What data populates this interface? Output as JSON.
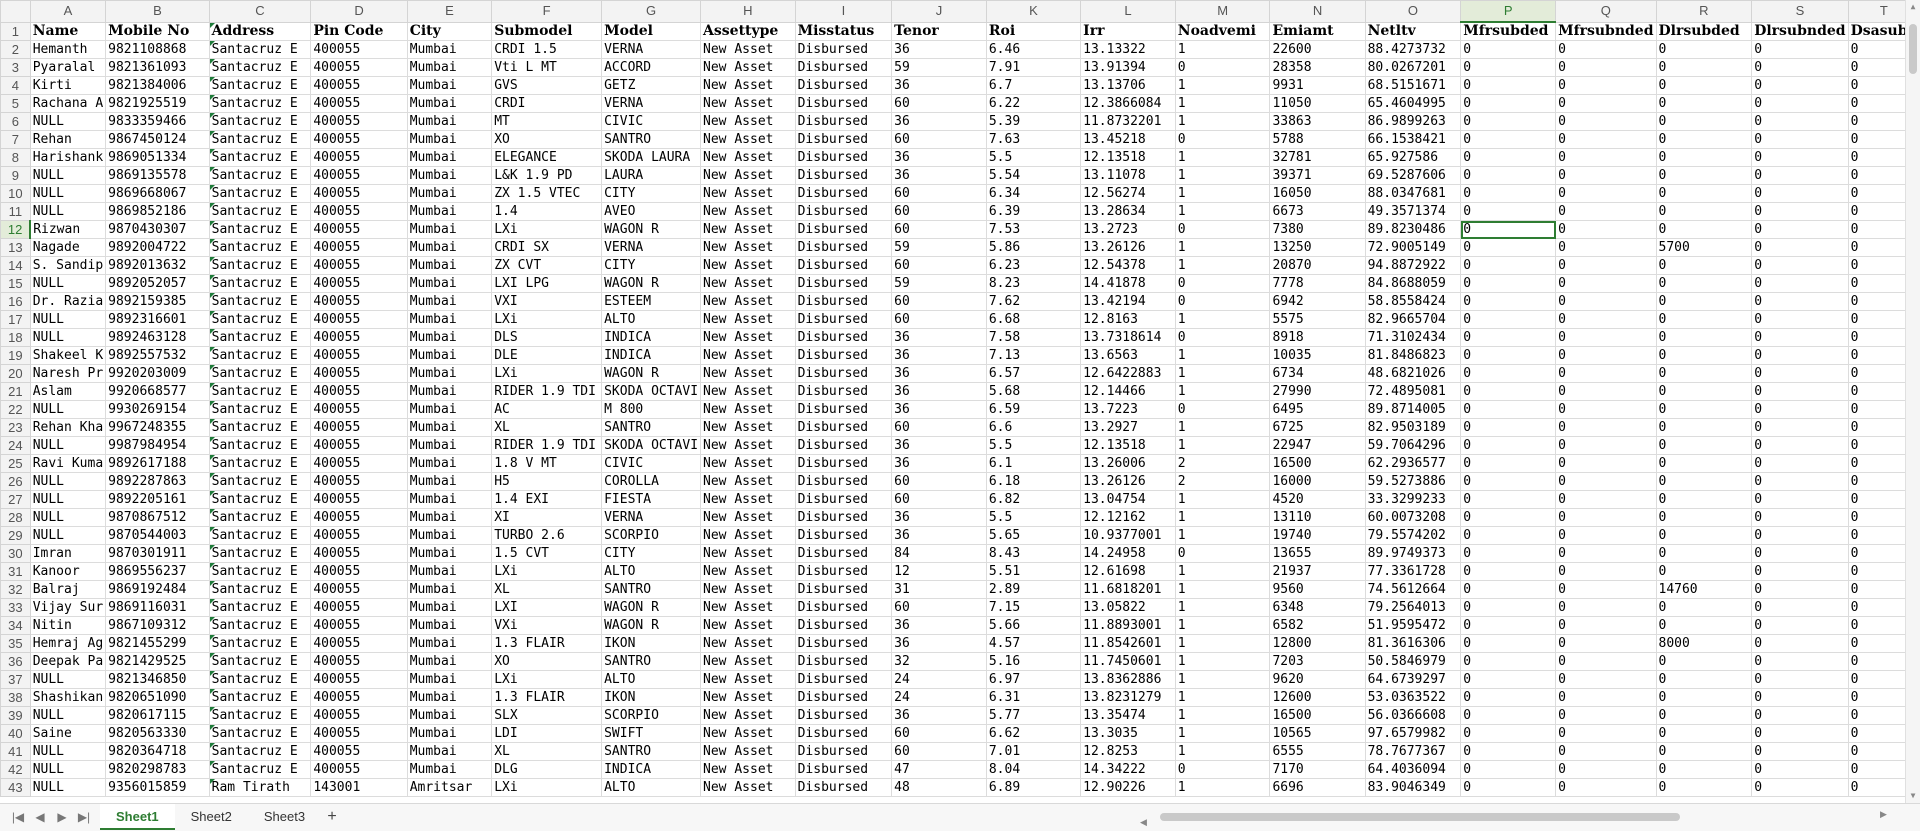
{
  "columns": [
    "A",
    "B",
    "C",
    "D",
    "E",
    "F",
    "G",
    "H",
    "I",
    "J",
    "K",
    "L",
    "M",
    "N",
    "O",
    "P",
    "Q",
    "R",
    "S",
    "T"
  ],
  "selected_column": "P",
  "selected_row": 12,
  "active_cell": {
    "row": 12,
    "col": "P"
  },
  "header_row": [
    "Name",
    "Mobile No",
    "Address",
    "Pin Code",
    "City",
    "Submodel",
    "Model",
    "Assettype",
    "Misstatus",
    "Tenor",
    "Roi",
    "Irr",
    "Noadvemi",
    "Emiamt",
    "Netltv",
    "Mfrsubded",
    "Mfrsubnded",
    "Dlrsubded",
    "Dlrsubnded",
    "Dsasubo"
  ],
  "rows": [
    [
      "Hemanth",
      "9821108868",
      "Santacruz E",
      "400055",
      "Mumbai",
      "CRDI 1.5",
      "VERNA",
      "New Asset",
      "Disbursed",
      "36",
      "6.46",
      "13.13322",
      "1",
      "22600",
      "88.4273732",
      "0",
      "0",
      "0",
      "0",
      "0"
    ],
    [
      "Pyaralal",
      "9821361093",
      "Santacruz E",
      "400055",
      "Mumbai",
      "Vti L MT",
      "ACCORD",
      "New Asset",
      "Disbursed",
      "59",
      "7.91",
      "13.91394",
      "0",
      "28358",
      "80.0267201",
      "0",
      "0",
      "0",
      "0",
      "0"
    ],
    [
      "Kirti",
      "9821384006",
      "Santacruz E",
      "400055",
      "Mumbai",
      "GVS",
      "GETZ",
      "New Asset",
      "Disbursed",
      "36",
      "6.7",
      "13.13706",
      "1",
      "9931",
      "68.5151671",
      "0",
      "0",
      "0",
      "0",
      "0"
    ],
    [
      "Rachana A",
      "9821925519",
      "Santacruz E",
      "400055",
      "Mumbai",
      "CRDI",
      "VERNA",
      "New Asset",
      "Disbursed",
      "60",
      "6.22",
      "12.3866084",
      "1",
      "11050",
      "65.4604995",
      "0",
      "0",
      "0",
      "0",
      "0"
    ],
    [
      "NULL",
      "9833359466",
      "Santacruz E",
      "400055",
      "Mumbai",
      "MT",
      "CIVIC",
      "New Asset",
      "Disbursed",
      "36",
      "5.39",
      "11.8732201",
      "1",
      "33863",
      "86.9899263",
      "0",
      "0",
      "0",
      "0",
      "0"
    ],
    [
      "Rehan",
      "9867450124",
      "Santacruz E",
      "400055",
      "Mumbai",
      "XO",
      "SANTRO",
      "New Asset",
      "Disbursed",
      "60",
      "7.63",
      "13.45218",
      "0",
      "5788",
      "66.1538421",
      "0",
      "0",
      "0",
      "0",
      "0"
    ],
    [
      "Harishank",
      "9869051334",
      "Santacruz E",
      "400055",
      "Mumbai",
      "ELEGANCE",
      "SKODA LAURA",
      "New Asset",
      "Disbursed",
      "36",
      "5.5",
      "12.13518",
      "1",
      "32781",
      "65.927586",
      "0",
      "0",
      "0",
      "0",
      "0"
    ],
    [
      "NULL",
      "9869135578",
      "Santacruz E",
      "400055",
      "Mumbai",
      "L&K 1.9 PD",
      "LAURA",
      "New Asset",
      "Disbursed",
      "36",
      "5.54",
      "13.11078",
      "1",
      "39371",
      "69.5287606",
      "0",
      "0",
      "0",
      "0",
      "0"
    ],
    [
      "NULL",
      "9869668067",
      "Santacruz E",
      "400055",
      "Mumbai",
      "ZX 1.5 VTEC",
      "CITY",
      "New Asset",
      "Disbursed",
      "60",
      "6.34",
      "12.56274",
      "1",
      "16050",
      "88.0347681",
      "0",
      "0",
      "0",
      "0",
      "0"
    ],
    [
      "NULL",
      "9869852186",
      "Santacruz E",
      "400055",
      "Mumbai",
      "1.4",
      "AVEO",
      "New Asset",
      "Disbursed",
      "60",
      "6.39",
      "13.28634",
      "1",
      "6673",
      "49.3571374",
      "0",
      "0",
      "0",
      "0",
      "0"
    ],
    [
      "Rizwan",
      "9870430307",
      "Santacruz E",
      "400055",
      "Mumbai",
      "LXi",
      "WAGON R",
      "New Asset",
      "Disbursed",
      "60",
      "7.53",
      "13.2723",
      "0",
      "7380",
      "89.8230486",
      "0",
      "0",
      "0",
      "0",
      "0"
    ],
    [
      "Nagade",
      "9892004722",
      "Santacruz E",
      "400055",
      "Mumbai",
      "CRDI SX",
      "VERNA",
      "New Asset",
      "Disbursed",
      "59",
      "5.86",
      "13.26126",
      "1",
      "13250",
      "72.9005149",
      "0",
      "0",
      "5700",
      "0",
      "0"
    ],
    [
      "S. Sandip",
      "9892013632",
      "Santacruz E",
      "400055",
      "Mumbai",
      "ZX CVT",
      "CITY",
      "New Asset",
      "Disbursed",
      "60",
      "6.23",
      "12.54378",
      "1",
      "20870",
      "94.8872922",
      "0",
      "0",
      "0",
      "0",
      "0"
    ],
    [
      "NULL",
      "9892052057",
      "Santacruz E",
      "400055",
      "Mumbai",
      "LXI LPG",
      "WAGON R",
      "New Asset",
      "Disbursed",
      "59",
      "8.23",
      "14.41878",
      "0",
      "7778",
      "84.8688059",
      "0",
      "0",
      "0",
      "0",
      "0"
    ],
    [
      "Dr. Razia",
      "9892159385",
      "Santacruz E",
      "400055",
      "Mumbai",
      "VXI",
      "ESTEEM",
      "New Asset",
      "Disbursed",
      "60",
      "7.62",
      "13.42194",
      "0",
      "6942",
      "58.8558424",
      "0",
      "0",
      "0",
      "0",
      "0"
    ],
    [
      "NULL",
      "9892316601",
      "Santacruz E",
      "400055",
      "Mumbai",
      "LXi",
      "ALTO",
      "New Asset",
      "Disbursed",
      "60",
      "6.68",
      "12.8163",
      "1",
      "5575",
      "82.9665704",
      "0",
      "0",
      "0",
      "0",
      "0"
    ],
    [
      "NULL",
      "9892463128",
      "Santacruz E",
      "400055",
      "Mumbai",
      "DLS",
      "INDICA",
      "New Asset",
      "Disbursed",
      "36",
      "7.58",
      "13.7318614",
      "0",
      "8918",
      "71.3102434",
      "0",
      "0",
      "0",
      "0",
      "0"
    ],
    [
      "Shakeel K",
      "9892557532",
      "Santacruz E",
      "400055",
      "Mumbai",
      "DLE",
      "INDICA",
      "New Asset",
      "Disbursed",
      "36",
      "7.13",
      "13.6563",
      "1",
      "10035",
      "81.8486823",
      "0",
      "0",
      "0",
      "0",
      "0"
    ],
    [
      "Naresh Pr",
      "9920203009",
      "Santacruz E",
      "400055",
      "Mumbai",
      "LXi",
      "WAGON R",
      "New Asset",
      "Disbursed",
      "36",
      "6.57",
      "12.6422883",
      "1",
      "6734",
      "48.6821026",
      "0",
      "0",
      "0",
      "0",
      "0"
    ],
    [
      "Aslam",
      "9920668577",
      "Santacruz E",
      "400055",
      "Mumbai",
      "RIDER 1.9 TDI",
      "SKODA OCTAVI",
      "New Asset",
      "Disbursed",
      "36",
      "5.68",
      "12.14466",
      "1",
      "27990",
      "72.4895081",
      "0",
      "0",
      "0",
      "0",
      "0"
    ],
    [
      "NULL",
      "9930269154",
      "Santacruz E",
      "400055",
      "Mumbai",
      "AC",
      "M 800",
      "New Asset",
      "Disbursed",
      "36",
      "6.59",
      "13.7223",
      "0",
      "6495",
      "89.8714005",
      "0",
      "0",
      "0",
      "0",
      "0"
    ],
    [
      "Rehan Kha",
      "9967248355",
      "Santacruz E",
      "400055",
      "Mumbai",
      "XL",
      "SANTRO",
      "New Asset",
      "Disbursed",
      "60",
      "6.6",
      "13.2927",
      "1",
      "6725",
      "82.9503189",
      "0",
      "0",
      "0",
      "0",
      "0"
    ],
    [
      "NULL",
      "9987984954",
      "Santacruz E",
      "400055",
      "Mumbai",
      "RIDER 1.9 TDI",
      "SKODA OCTAVI",
      "New Asset",
      "Disbursed",
      "36",
      "5.5",
      "12.13518",
      "1",
      "22947",
      "59.7064296",
      "0",
      "0",
      "0",
      "0",
      "0"
    ],
    [
      "Ravi Kuma",
      "9892617188",
      "Santacruz E",
      "400055",
      "Mumbai",
      "1.8 V MT",
      "CIVIC",
      "New Asset",
      "Disbursed",
      "36",
      "6.1",
      "13.26006",
      "2",
      "16500",
      "62.2936577",
      "0",
      "0",
      "0",
      "0",
      "0"
    ],
    [
      "NULL",
      "9892287863",
      "Santacruz E",
      "400055",
      "Mumbai",
      "H5",
      "COROLLA",
      "New Asset",
      "Disbursed",
      "60",
      "6.18",
      "13.26126",
      "2",
      "16000",
      "59.5273886",
      "0",
      "0",
      "0",
      "0",
      "0"
    ],
    [
      "NULL",
      "9892205161",
      "Santacruz E",
      "400055",
      "Mumbai",
      "1.4 EXI",
      "FIESTA",
      "New Asset",
      "Disbursed",
      "60",
      "6.82",
      "13.04754",
      "1",
      "4520",
      "33.3299233",
      "0",
      "0",
      "0",
      "0",
      "0"
    ],
    [
      "NULL",
      "9870867512",
      "Santacruz E",
      "400055",
      "Mumbai",
      "XI",
      "VERNA",
      "New Asset",
      "Disbursed",
      "36",
      "5.5",
      "12.12162",
      "1",
      "13110",
      "60.0073208",
      "0",
      "0",
      "0",
      "0",
      "0"
    ],
    [
      "NULL",
      "9870544003",
      "Santacruz E",
      "400055",
      "Mumbai",
      "TURBO 2.6",
      "SCORPIO",
      "New Asset",
      "Disbursed",
      "36",
      "5.65",
      "10.9377001",
      "1",
      "19740",
      "79.5574202",
      "0",
      "0",
      "0",
      "0",
      "0"
    ],
    [
      "Imran",
      "9870301911",
      "Santacruz E",
      "400055",
      "Mumbai",
      "1.5 CVT",
      "CITY",
      "New Asset",
      "Disbursed",
      "84",
      "8.43",
      "14.24958",
      "0",
      "13655",
      "89.9749373",
      "0",
      "0",
      "0",
      "0",
      "0"
    ],
    [
      "Kanoor",
      "9869556237",
      "Santacruz E",
      "400055",
      "Mumbai",
      "LXi",
      "ALTO",
      "New Asset",
      "Disbursed",
      "12",
      "5.51",
      "12.61698",
      "1",
      "21937",
      "77.3361728",
      "0",
      "0",
      "0",
      "0",
      "0"
    ],
    [
      "Balraj",
      "9869192484",
      "Santacruz E",
      "400055",
      "Mumbai",
      "XL",
      "SANTRO",
      "New Asset",
      "Disbursed",
      "31",
      "2.89",
      "11.6818201",
      "1",
      "9560",
      "74.5612664",
      "0",
      "0",
      "14760",
      "0",
      "0"
    ],
    [
      "Vijay Sur",
      "9869116031",
      "Santacruz E",
      "400055",
      "Mumbai",
      "LXI",
      "WAGON R",
      "New Asset",
      "Disbursed",
      "60",
      "7.15",
      "13.05822",
      "1",
      "6348",
      "79.2564013",
      "0",
      "0",
      "0",
      "0",
      "0"
    ],
    [
      "Nitin",
      "9867109312",
      "Santacruz E",
      "400055",
      "Mumbai",
      "VXi",
      "WAGON R",
      "New Asset",
      "Disbursed",
      "36",
      "5.66",
      "11.8893001",
      "1",
      "6582",
      "51.9595472",
      "0",
      "0",
      "0",
      "0",
      "0"
    ],
    [
      "Hemraj Ag",
      "9821455299",
      "Santacruz E",
      "400055",
      "Mumbai",
      "1.3 FLAIR",
      "IKON",
      "New Asset",
      "Disbursed",
      "36",
      "4.57",
      "11.8542601",
      "1",
      "12800",
      "81.3616306",
      "0",
      "0",
      "8000",
      "0",
      "0"
    ],
    [
      "Deepak Pa",
      "9821429525",
      "Santacruz E",
      "400055",
      "Mumbai",
      "XO",
      "SANTRO",
      "New Asset",
      "Disbursed",
      "32",
      "5.16",
      "11.7450601",
      "1",
      "7203",
      "50.5846979",
      "0",
      "0",
      "0",
      "0",
      "0"
    ],
    [
      "NULL",
      "9821346850",
      "Santacruz E",
      "400055",
      "Mumbai",
      "LXi",
      "ALTO",
      "New Asset",
      "Disbursed",
      "24",
      "6.97",
      "13.8362886",
      "1",
      "9620",
      "64.6739297",
      "0",
      "0",
      "0",
      "0",
      "0"
    ],
    [
      "Shashikan",
      "9820651090",
      "Santacruz E",
      "400055",
      "Mumbai",
      "1.3 FLAIR",
      "IKON",
      "New Asset",
      "Disbursed",
      "24",
      "6.31",
      "13.8231279",
      "1",
      "12600",
      "53.0363522",
      "0",
      "0",
      "0",
      "0",
      "0"
    ],
    [
      "NULL",
      "9820617115",
      "Santacruz E",
      "400055",
      "Mumbai",
      "SLX",
      "SCORPIO",
      "New Asset",
      "Disbursed",
      "36",
      "5.77",
      "13.35474",
      "1",
      "16500",
      "56.0366608",
      "0",
      "0",
      "0",
      "0",
      "0"
    ],
    [
      "Saine",
      "9820563330",
      "Santacruz E",
      "400055",
      "Mumbai",
      "LDI",
      "SWIFT",
      "New Asset",
      "Disbursed",
      "60",
      "6.62",
      "13.3035",
      "1",
      "10565",
      "97.6579982",
      "0",
      "0",
      "0",
      "0",
      "0"
    ],
    [
      "NULL",
      "9820364718",
      "Santacruz E",
      "400055",
      "Mumbai",
      "XL",
      "SANTRO",
      "New Asset",
      "Disbursed",
      "60",
      "7.01",
      "12.8253",
      "1",
      "6555",
      "78.7677367",
      "0",
      "0",
      "0",
      "0",
      "0"
    ],
    [
      "NULL",
      "9820298783",
      "Santacruz E",
      "400055",
      "Mumbai",
      "DLG",
      "INDICA",
      "New Asset",
      "Disbursed",
      "47",
      "8.04",
      "14.34222",
      "0",
      "7170",
      "64.4036094",
      "0",
      "0",
      "0",
      "0",
      "0"
    ],
    [
      "NULL",
      "9356015859",
      "Ram Tirath",
      "143001",
      "Amritsar",
      "LXi",
      "ALTO",
      "New Asset",
      "Disbursed",
      "48",
      "6.89",
      "12.90226",
      "1",
      "6696",
      "83.9046349",
      "0",
      "0",
      "0",
      "0",
      "0"
    ]
  ],
  "sheet_tabs": [
    "Sheet1",
    "Sheet2",
    "Sheet3"
  ],
  "active_tab": "Sheet1",
  "add_tab_label": "+",
  "nav_icons": [
    "first-sheet-icon",
    "prev-sheet-icon",
    "next-sheet-icon",
    "last-sheet-icon"
  ],
  "accent_color": "#2e7d32"
}
